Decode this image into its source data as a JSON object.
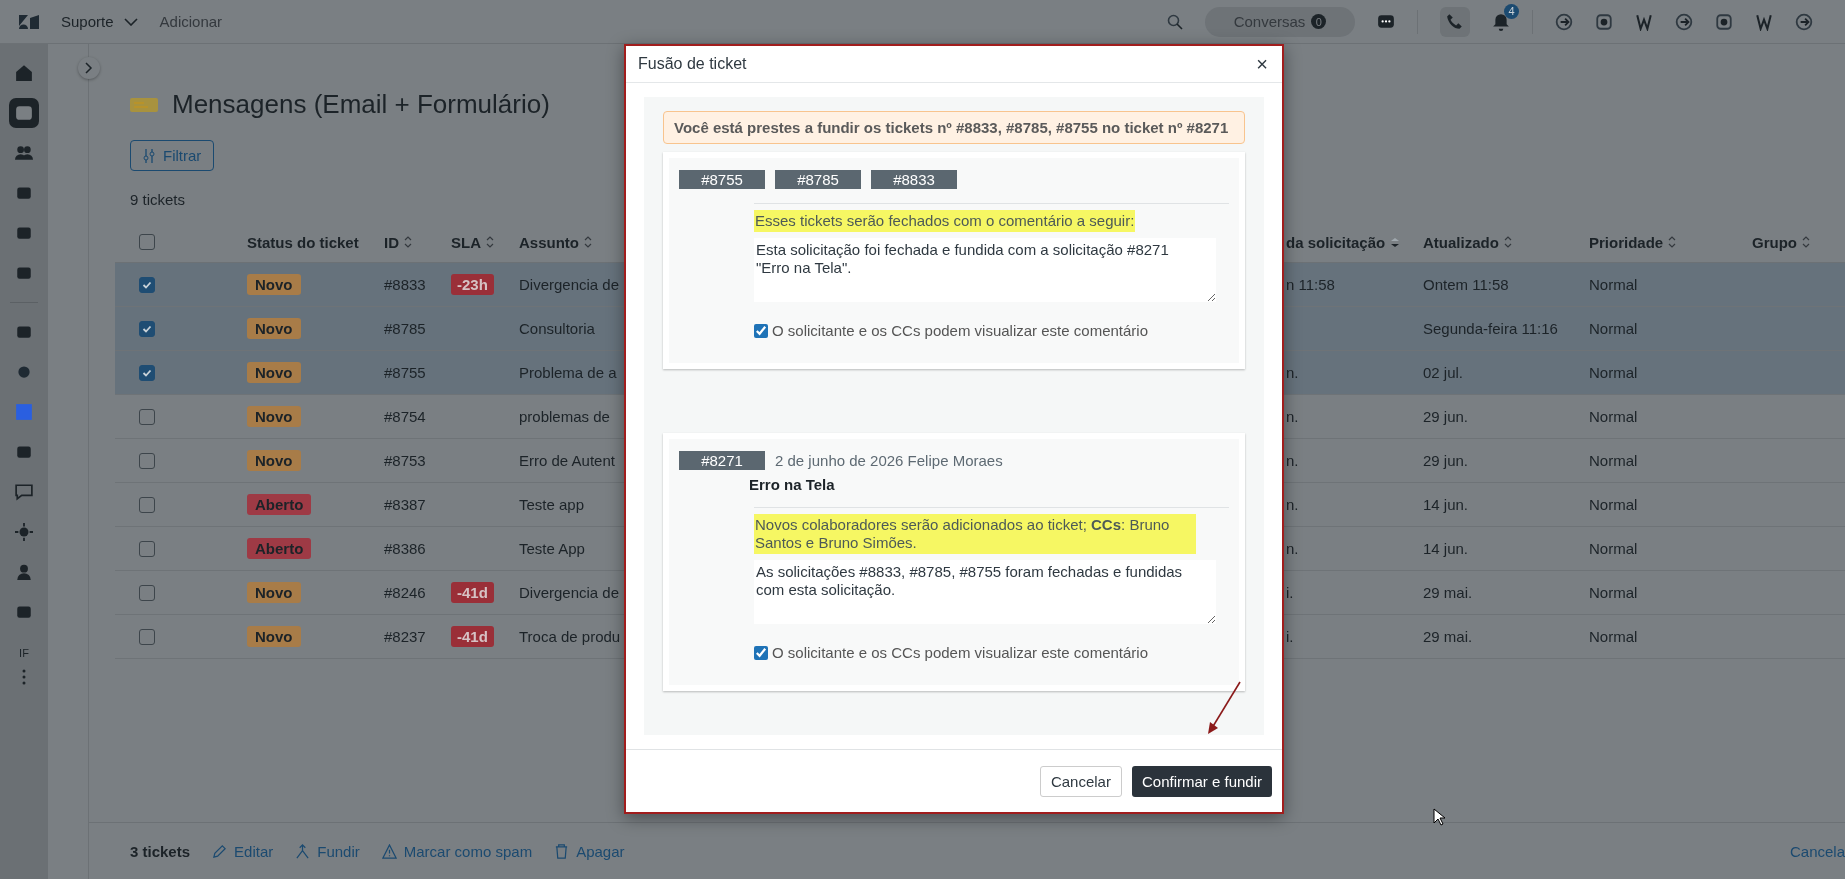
{
  "topbar": {
    "workspace": "Suporte",
    "add": "Adicionar",
    "conversations": {
      "label": "Conversas",
      "count": "0"
    },
    "notifications": {
      "count": "4"
    }
  },
  "sidebar": {
    "items": [
      {
        "selected": false
      },
      {
        "selected": true
      },
      {
        "selected": false
      },
      {
        "selected": false
      },
      {
        "selected": false
      },
      {
        "selected": false
      },
      {
        "selected": false
      },
      {
        "selected": false
      },
      {
        "selected": false
      },
      {
        "selected": false
      },
      {
        "selected": false
      },
      {
        "selected": false
      },
      {
        "selected": false
      },
      {
        "selected": false
      }
    ],
    "initials": "IF"
  },
  "view": {
    "title": "Mensagens (Email + Formulário)",
    "filter_button": "Filtrar",
    "count": "9 tickets"
  },
  "table": {
    "select_all": {
      "checked": false
    },
    "columns": [
      {
        "label": "Status do ticket",
        "sortable": false,
        "sorted": false
      },
      {
        "label": "ID",
        "sortable": true,
        "sorted": false
      },
      {
        "label": "SLA",
        "sortable": true,
        "sorted": false
      },
      {
        "label": "Assunto",
        "sortable": true,
        "sorted": false
      },
      {
        "label": "da solicitação",
        "sortable": true,
        "sorted": true
      },
      {
        "label": "Atualizado",
        "sortable": true,
        "sorted": false
      },
      {
        "label": "Prioridade",
        "sortable": true,
        "sorted": false
      },
      {
        "label": "Grupo",
        "sortable": true,
        "sorted": false
      }
    ],
    "rows": [
      {
        "selected": true,
        "status": {
          "label": "Novo",
          "color": "#a87c48"
        },
        "id": "#8833",
        "sla": "-23h",
        "subject": "Divergencia de",
        "column_5": "n 11:58",
        "updated": "Ontem 11:58",
        "priority": "Normal"
      },
      {
        "selected": true,
        "status": {
          "label": "Novo",
          "color": "#a87c48"
        },
        "id": "#8785",
        "sla": "",
        "subject": "Consultoria",
        "column_5": "",
        "updated": "Segunda-feira 11:16",
        "priority": "Normal"
      },
      {
        "selected": true,
        "status": {
          "label": "Novo",
          "color": "#a87c48"
        },
        "id": "#8755",
        "sla": "",
        "subject": "Problema de a",
        "column_5": "n.",
        "updated": "02 jul.",
        "priority": "Normal"
      },
      {
        "selected": false,
        "status": {
          "label": "Novo",
          "color": "#a87c48"
        },
        "id": "#8754",
        "sla": "",
        "subject": "problemas de",
        "column_5": "n.",
        "updated": "29 jun.",
        "priority": "Normal"
      },
      {
        "selected": false,
        "status": {
          "label": "Novo",
          "color": "#a87c48"
        },
        "id": "#8753",
        "sla": "",
        "subject": "Erro de Autent",
        "column_5": "n.",
        "updated": "29 jun.",
        "priority": "Normal"
      },
      {
        "selected": false,
        "status": {
          "label": "Aberto",
          "color": "#9e3a45"
        },
        "id": "#8387",
        "sla": "",
        "subject": "Teste app",
        "column_5": "n.",
        "updated": "14 jun.",
        "priority": "Normal"
      },
      {
        "selected": false,
        "status": {
          "label": "Aberto",
          "color": "#9e3a45"
        },
        "id": "#8386",
        "sla": "",
        "subject": "Teste App",
        "column_5": "n.",
        "updated": "14 jun.",
        "priority": "Normal"
      },
      {
        "selected": false,
        "status": {
          "label": "Novo",
          "color": "#a87c48"
        },
        "id": "#8246",
        "sla": "-41d",
        "subject": "Divergencia de",
        "column_5": "i.",
        "updated": "29 mai.",
        "priority": "Normal"
      },
      {
        "selected": false,
        "status": {
          "label": "Novo",
          "color": "#a87c48"
        },
        "id": "#8237",
        "sla": "-41d",
        "subject": "Troca de produ",
        "column_5": "i.",
        "updated": "29 mai.",
        "priority": "Normal"
      }
    ]
  },
  "bulk_bar": {
    "count": "3 tickets",
    "actions": [
      "Editar",
      "Fundir",
      "Marcar como spam",
      "Apagar"
    ],
    "cancel": "Cancela"
  },
  "modal": {
    "title": "Fusão de ticket",
    "close": "×",
    "notice": "Você está prestes a fundir os tickets nº #8833, #8785, #8755 no ticket nº #8271",
    "source": {
      "tags": [
        "#8755",
        "#8785",
        "#8833"
      ],
      "note": "Esses tickets serão fechados com o comentário a seguir:",
      "comment": "Esta solicitação foi fechada e fundida com a solicitação #8271 \"Erro na Tela\".",
      "public": {
        "label": "O solicitante e os CCs podem visualizar este comentário",
        "checked": true
      }
    },
    "target": {
      "tag": "#8271",
      "meta": "2 de junho de 2026 Felipe Moraes",
      "subject": "Erro na Tela",
      "note": "Novos colaboradores serão adicionados ao ticket; **CCs**: Bruno Santos e Bruno Simões.",
      "comment": "As solicitações #8833, #8785, #8755 foram fechadas e fundidas com esta solicitação.",
      "public": {
        "label": "O solicitante e os CCs podem visualizar este comentário",
        "checked": true
      }
    },
    "buttons": {
      "cancel": "Cancelar",
      "confirm": "Confirmar e fundir"
    }
  }
}
